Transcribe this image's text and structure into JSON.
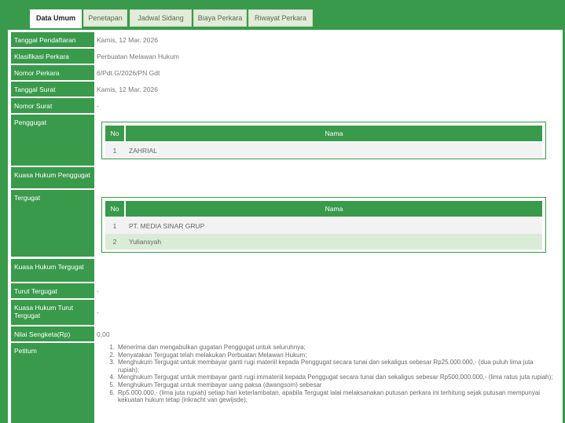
{
  "tabs": [
    {
      "label": "Data Umum",
      "active": true
    },
    {
      "label": "Penetapan"
    },
    {
      "label": "Jadwal Sidang"
    },
    {
      "label": "Biaya Perkara"
    },
    {
      "label": "Riwayat Perkara"
    }
  ],
  "fields": {
    "tanggal_pendaftaran": {
      "label": "Tanggal Pendaftaran",
      "value": "Kamis, 12 Mar. 2026"
    },
    "klasifikasi_perkara": {
      "label": "Klasifikasi Perkara",
      "value": "Perbuatan Melawan Hukum"
    },
    "nomor_perkara": {
      "label": "Nomor Perkara",
      "value": "6/Pdt.G/2026/PN Gdt"
    },
    "tanggal_surat": {
      "label": "Tanggal Surat",
      "value": "Kamis, 12 Mar. 2026"
    },
    "nomor_surat": {
      "label": "Nomor Surat",
      "value": "-"
    },
    "penggugat": {
      "label": "Penggugat"
    },
    "kuasa_penggugat": {
      "label": "Kuasa Hukum Penggugat"
    },
    "tergugat": {
      "label": "Tergugat"
    },
    "kuasa_tergugat": {
      "label": "Kuasa Hukum Tergugat"
    },
    "turut_tergugat": {
      "label": "Turut Tergugat",
      "value": "-"
    },
    "kuasa_turut_tergugat": {
      "label": "Kuasa Hukum Turut Tergugat",
      "value": "-"
    },
    "nilai_sengketa": {
      "label": "Nilai Sengketa(Rp)",
      "value": "0,00"
    },
    "petitum": {
      "label": "Petitum"
    }
  },
  "penggugat_table": {
    "col_no": "No",
    "col_nama": "Nama",
    "rows": [
      {
        "no": "1",
        "nama": "ZAHRIAL"
      }
    ]
  },
  "tergugat_table": {
    "col_no": "No",
    "col_nama": "Nama",
    "rows": [
      {
        "no": "1",
        "nama": "PT. MEDIA SINAR GRUP"
      },
      {
        "no": "2",
        "nama": "Yuliansyah"
      }
    ]
  },
  "petitum_items": [
    {
      "num": "1.",
      "text": "Menerima dan mengabulkan gugatan Penggugat untuk seluruhnya;"
    },
    {
      "num": "2.",
      "text": "Menyatakan Tergugat telah melakukan Perbuatan Melawan Hukum;"
    },
    {
      "num": "3.",
      "text": "Menghukum Tergugat untuk membayar ganti rugi materiil kepada Penggugat secara tunai dan sekaligus sebesar Rp25.000.000,- (dua puluh lima juta rupiah);"
    },
    {
      "num": "4.",
      "text": "Menghukum Tergugat untuk membayar ganti rugi immateriil kepada Penggugat secara tunai dan sekaligus sebesar Rp500.000.000,- (lima ratus juta rupiah);"
    },
    {
      "num": "5.",
      "text": "Menghukum Tergugat untuk membayar uang paksa (dwangsom) sebesar"
    },
    {
      "num": "6.",
      "text": "Rp5.000.000,- (lima juta rupiah) setiap hari keterlambatan, apabila Tergugat lalai melaksanakan putusan perkara ini terhitung sejak putusan mempunyai kekuatan hukum tetap (inkracht van gewijsde);"
    }
  ],
  "colors": {
    "brand_green": "#3a9a4c",
    "tab_inactive": "#e3ecd9",
    "row_highlight": "#d9ecd5",
    "row_alt": "#f2f2f2"
  }
}
